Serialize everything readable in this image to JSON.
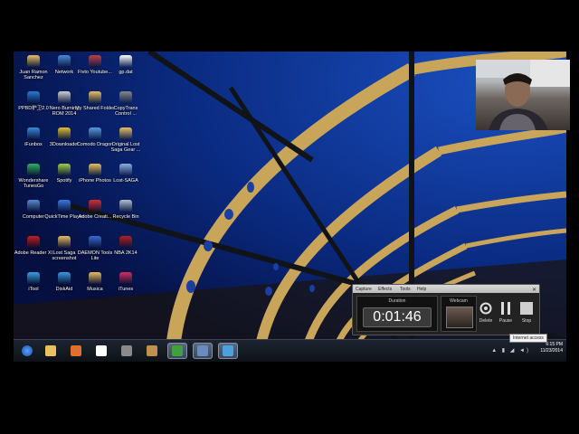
{
  "desktop": {
    "icons": [
      {
        "label": "Juan Ramon Sanchez",
        "icon": "folder-icon",
        "color": "#e8c060"
      },
      {
        "label": "Network",
        "icon": "network-icon",
        "color": "#4a8ad8"
      },
      {
        "label": "Fivto Youtube...",
        "icon": "app-icon",
        "color": "#c04040"
      },
      {
        "label": "gp.dat",
        "icon": "file-icon",
        "color": "#ffffff"
      },
      {
        "label": "PPBD护卫2.0",
        "icon": "app-icon",
        "color": "#2a7ad0"
      },
      {
        "label": "Nero Burning ROM 2014",
        "icon": "nero-icon",
        "color": "#d0d0d0"
      },
      {
        "label": "My Shared Folder",
        "icon": "folder-icon",
        "color": "#e8c060"
      },
      {
        "label": "CopyTrans Control ...",
        "icon": "copytrans-icon",
        "color": "#888888"
      },
      {
        "label": "iFunbox",
        "icon": "ifunbox-icon",
        "color": "#3a8ad8"
      },
      {
        "label": "3Downloader",
        "icon": "downloader-icon",
        "color": "#e0c030"
      },
      {
        "label": "Comodo Dragon",
        "icon": "comodo-icon",
        "color": "#5a9ae0"
      },
      {
        "label": "Original Lost Saga Gear ...",
        "icon": "folder-icon",
        "color": "#e8c060"
      },
      {
        "label": "Wondershare TunesGo",
        "icon": "tunesgo-icon",
        "color": "#30b060"
      },
      {
        "label": "Spotify",
        "icon": "spotify-icon",
        "color": "#a0d040"
      },
      {
        "label": "iPhone Photos",
        "icon": "folder-icon",
        "color": "#e8c060"
      },
      {
        "label": "Lost-SAGA",
        "icon": "game-icon",
        "color": "#8ab0e0"
      },
      {
        "label": "Computer",
        "icon": "computer-icon",
        "color": "#5a8ad0"
      },
      {
        "label": "QuickTime Player",
        "icon": "quicktime-icon",
        "color": "#3a7ae0"
      },
      {
        "label": "Adobe Creati...",
        "icon": "adobe-icon",
        "color": "#d03030"
      },
      {
        "label": "Recycle Bin",
        "icon": "recycle-bin-icon",
        "color": "#b0c0d0"
      },
      {
        "label": "Adobe Reader XI",
        "icon": "adobe-reader-icon",
        "color": "#c02020"
      },
      {
        "label": "Lost Saga screenshot",
        "icon": "folder-icon",
        "color": "#e8c060"
      },
      {
        "label": "DAEMON Tools Lite",
        "icon": "daemon-icon",
        "color": "#3a6ad0"
      },
      {
        "label": "NBA 2K14",
        "icon": "nba-icon",
        "color": "#b02020"
      },
      {
        "label": "iTool",
        "icon": "itool-icon",
        "color": "#3aa0e0"
      },
      {
        "label": "DiskAid",
        "icon": "diskaid-icon",
        "color": "#3a9ae0"
      },
      {
        "label": "Musica",
        "icon": "folder-icon",
        "color": "#e8c060"
      },
      {
        "label": "iTunes",
        "icon": "itunes-icon",
        "color": "#d03060"
      }
    ]
  },
  "taskbar": {
    "buttons": [
      {
        "icon": "explorer-icon",
        "color": "#e8c060",
        "active": false
      },
      {
        "icon": "media-player-icon",
        "color": "#e07030",
        "active": false
      },
      {
        "icon": "opera-icon",
        "color": "#ffffff",
        "active": false
      },
      {
        "icon": "app-icon",
        "color": "#8a8a8a",
        "active": false
      },
      {
        "icon": "game-icon",
        "color": "#c09050",
        "active": false
      },
      {
        "icon": "chrome-icon",
        "color": "#40a040",
        "active": true
      },
      {
        "icon": "game-icon",
        "color": "#6a8ac0",
        "active": true
      },
      {
        "icon": "app-icon",
        "color": "#4aa0e0",
        "active": true
      }
    ],
    "clock_time": "6:15 PM",
    "clock_date": "11/23/2014"
  },
  "recorder": {
    "menu": [
      "Capture",
      "Effects",
      "Tools",
      "Help"
    ],
    "duration_label": "Duration",
    "duration_value": "0:01:46",
    "webcam_label": "Webcam",
    "delete_label": "Delete",
    "pause_label": "Pause",
    "stop_label": "Stop"
  },
  "tooltip": "Internet access"
}
